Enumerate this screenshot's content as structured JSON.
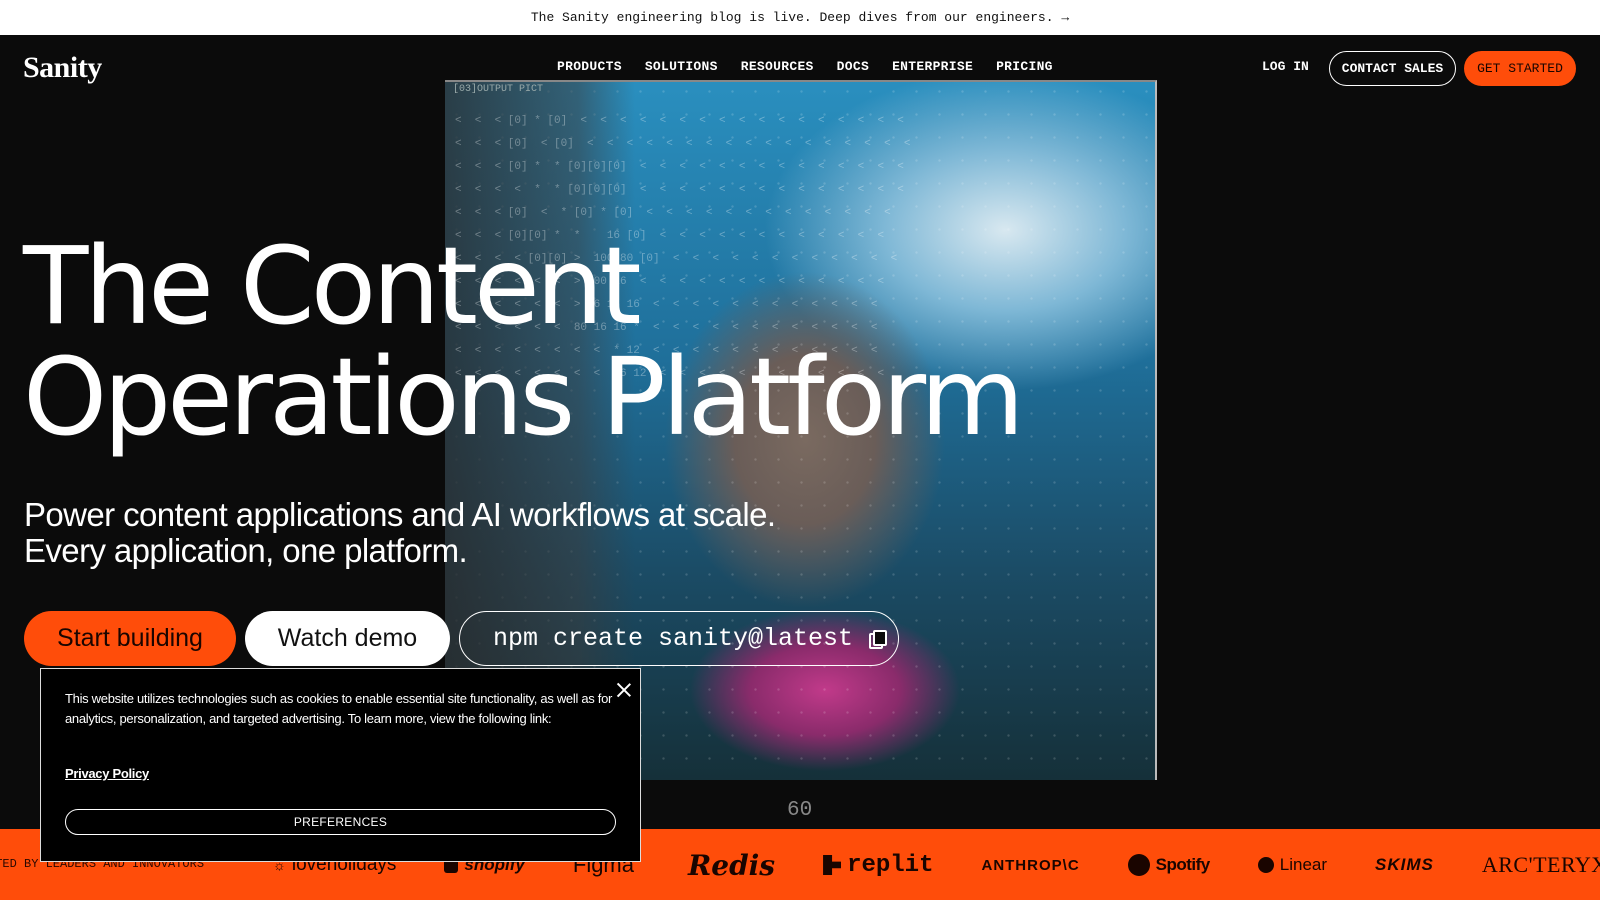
{
  "banner": {
    "text": "The Sanity engineering blog is live. Deep dives from our engineers. →"
  },
  "nav": {
    "logo": "Sanity",
    "items": [
      "PRODUCTS",
      "SOLUTIONS",
      "RESOURCES",
      "DOCS",
      "ENTERPRISE",
      "PRICING"
    ],
    "login": "LOG IN",
    "contact": "CONTACT SALES",
    "get_started": "GET STARTED"
  },
  "visual": {
    "tag": "[03]OUTPUT PICT",
    "frame_number": "60",
    "grid_text": "<  <  < [0] * [0]  <  <  <  <  <  <  <  <  <  <  <  <  <  <  <  <  <\n<  <  < [0]  < [0]  <  <  <  <  <  <  <  <  <  <  <  <  <  <  <  <  <\n<  <  < [0] *  * [0][0][0]  <  <  <  <  <  <  <  <  <  <  <  <  <  <\n<  <  <  <  *  * [0][0][0]  <  <  <  <  <  <  <  <  <  <  <  <  <  <\n<  <  < [0]  <  * [0] * [0]  <  <  <  <  <  <  <  <  <  <  <  <  <\n<  <  < [0][0] *  *    16 [0]  <  <  <  <  <  <  <  <  <  <  <  <\n<  <  <  < [0][0] >  100 80 [0]  <  <  <  <  <  <  <  <  <  <  <  <\n<  <  <  <  <  <  > 100 16  <  <  <  <  <  <  <  <  <  <  <  <  <\n<  <  <  <  <  <  > 16 16 16  <  <  <  <  <  <  <  <  <  <  <  <\n<  <  <  <  <  <  80 16 16 *  <  <  <  <  <  <  <  <  <  <  <  <\n<  <  <  <  <  <  <  <  * 12  <  <  <  <  <  <  <  <  <  <  <  <\n<  <  <  <  <  <  <  <  16 12  <  <  <  <  <  <  <  <  <  <  <  <"
  },
  "hero": {
    "line1": "The Content",
    "line2": "Operations Platform",
    "sub1": "Power content applications and AI workflows at scale.",
    "sub2": "Every application, one platform."
  },
  "cta": {
    "start": "Start building",
    "demo": "Watch demo",
    "npm": "npm create sanity@latest"
  },
  "cookie": {
    "text": "This website utilizes technologies such as cookies to enable essential site functionality, as well as for analytics, personalization, and targeted advertising. To learn more, view the following link:",
    "privacy": "Privacy Policy",
    "preferences": "PREFERENCES"
  },
  "strip": {
    "lead": "STED BY LEADERS AND INNOVATORS",
    "logos": [
      "loveholidays",
      "shopify",
      "Figma",
      "Redis",
      "replit",
      "ANTHROP\\C",
      "Spotify",
      "Linear",
      "SKIMS",
      "ARC'TERYX"
    ]
  },
  "colors": {
    "accent": "#ff4d0a",
    "background": "#0b0b0b",
    "text": "#ffffff"
  }
}
